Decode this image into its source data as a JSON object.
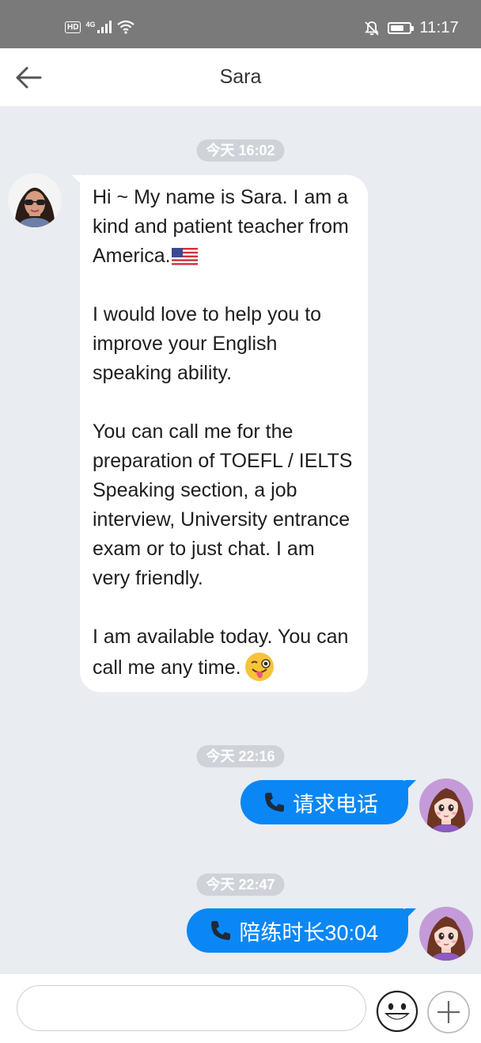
{
  "status_bar": {
    "hd": "HD",
    "network": "4G",
    "time": "11:17"
  },
  "header": {
    "title": "Sara",
    "back_icon": "arrow-left-icon"
  },
  "messages": [
    {
      "type": "time",
      "text": "今天 16:02"
    },
    {
      "type": "incoming",
      "sender": "Sara",
      "paragraphs": [
        "Hi ~  My name is Sara. I am a kind and patient  teacher from America.",
        "I would love to help you to improve your English speaking ability.",
        "You can call me for the preparation of TOEFL / IELTS Speaking section, a job interview,  University entrance exam or to just chat. I am very friendly.",
        "I am available today. You can call me any time."
      ],
      "emoji": [
        "us-flag-icon",
        "winking-face-tongue-icon"
      ]
    },
    {
      "type": "time",
      "text": "今天 22:16"
    },
    {
      "type": "outgoing",
      "icon": "phone-icon",
      "text": "请求电话"
    },
    {
      "type": "time",
      "text": "今天 22:47"
    },
    {
      "type": "outgoing",
      "icon": "phone-icon",
      "text": "陪练时长30:04"
    }
  ],
  "input_bar": {
    "placeholder": "",
    "emoji_icon": "smiley-icon",
    "plus_icon": "plus-icon"
  },
  "colors": {
    "outgoing_bubble": "#0a87f5",
    "chat_background": "#e9ecf1",
    "status_bar": "#7a7a7a"
  }
}
